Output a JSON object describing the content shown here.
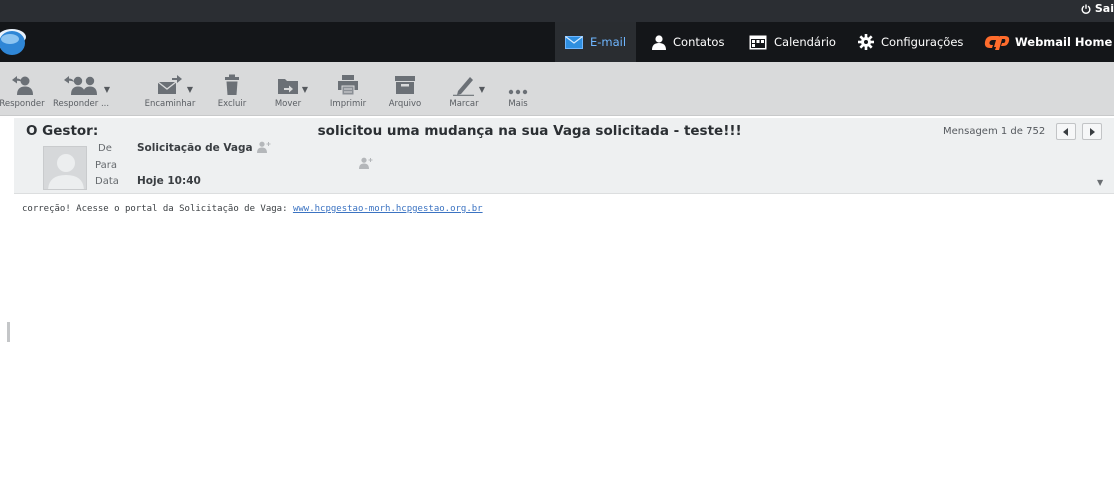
{
  "user": {
    "label": "Sai",
    "icon": "power-icon"
  },
  "nav": {
    "items": [
      {
        "label": "E-mail",
        "icon": "envelope-icon",
        "active": true
      },
      {
        "label": "Contatos",
        "icon": "person-icon"
      },
      {
        "label": "Calendário",
        "icon": "calendar-icon"
      },
      {
        "label": "Configurações",
        "icon": "gear-icon"
      },
      {
        "label": "Webmail Home",
        "icon": "cpanel-logo-icon"
      }
    ]
  },
  "toolbar": {
    "reply": "Responder",
    "reply_all": "Responder ...",
    "forward": "Encaminhar",
    "delete": "Excluir",
    "move": "Mover",
    "print": "Imprimir",
    "archive": "Arquivo",
    "mark": "Marcar",
    "more": "Mais"
  },
  "message": {
    "subject_prefix": "O Gestor:",
    "subject_suffix": "solicitou uma mudança na sua Vaga solicitada - teste!!!",
    "counter": "Mensagem 1 de 752",
    "from_label": "De",
    "from_value": "Solicitação de Vaga",
    "to_label": "Para",
    "to_value": "",
    "date_label": "Data",
    "date_value": "Hoje 10:40",
    "body_text": "correção! Acesse o portal da Solicitação de Vaga:",
    "body_link": "www.hcpgestao-morh.hcpgestao.org.br"
  },
  "colors": {
    "accent": "#2f8fe0",
    "toolbar_bg": "#d9dadb",
    "nav_bg": "#141619"
  }
}
